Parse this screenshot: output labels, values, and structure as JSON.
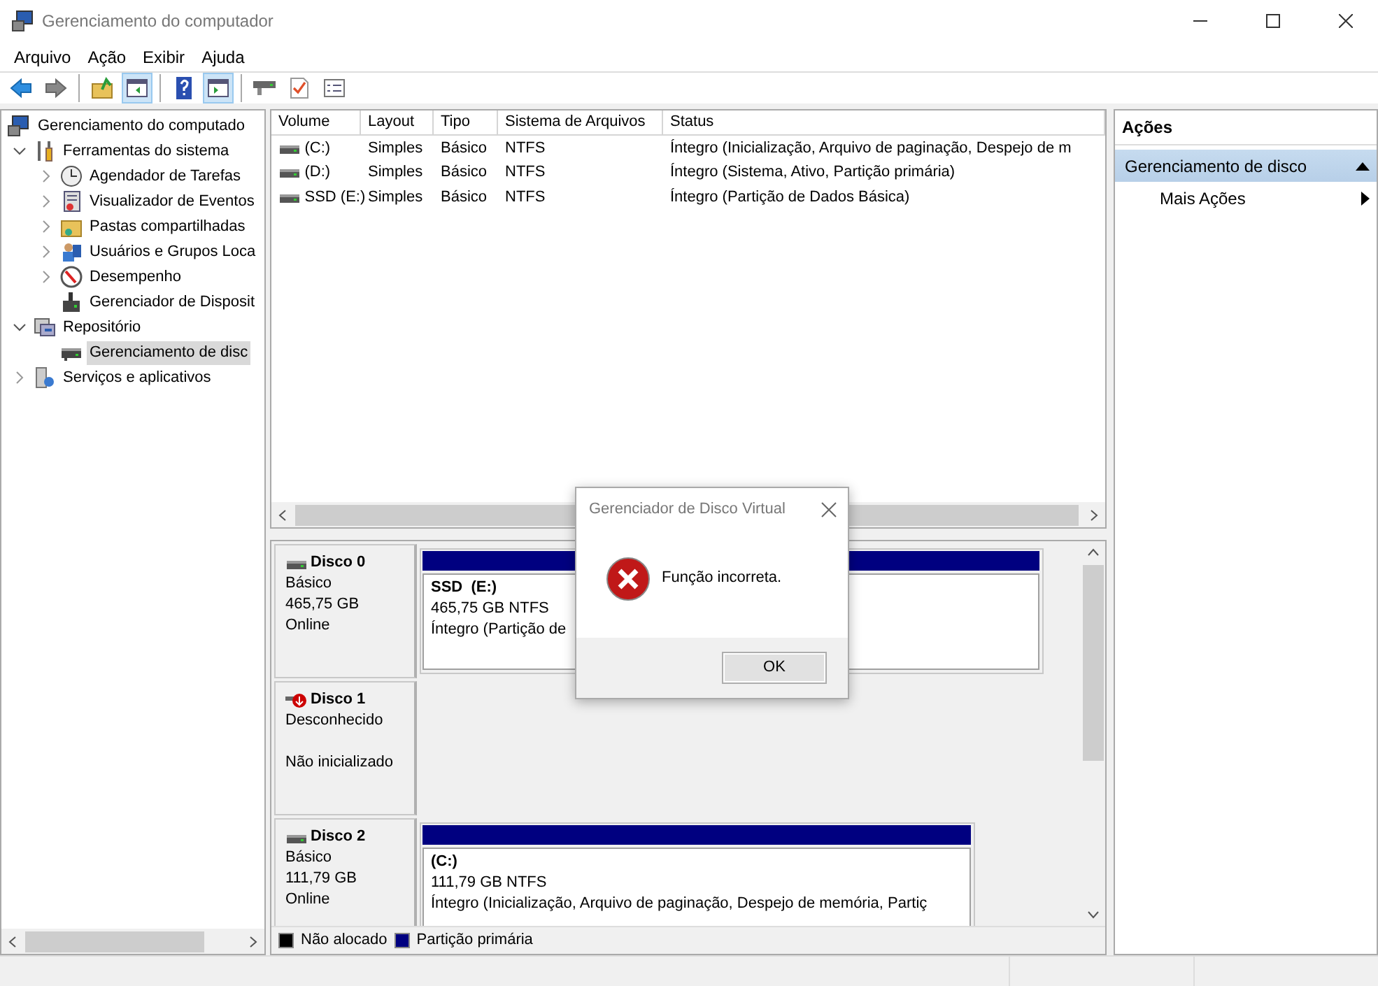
{
  "window": {
    "title": "Gerenciamento do computador"
  },
  "menu": [
    "Arquivo",
    "Ação",
    "Exibir",
    "Ajuda"
  ],
  "toolbar": [
    {
      "kind": "back",
      "pressed": false
    },
    {
      "kind": "forward",
      "pressed": false
    },
    {
      "kind": "sep"
    },
    {
      "kind": "up",
      "pressed": false
    },
    {
      "kind": "tree",
      "pressed": true
    },
    {
      "kind": "sep"
    },
    {
      "kind": "help",
      "pressed": false
    },
    {
      "kind": "actionpane",
      "pressed": true
    },
    {
      "kind": "sep"
    },
    {
      "kind": "drive",
      "pressed": false
    },
    {
      "kind": "check",
      "pressed": false
    },
    {
      "kind": "list",
      "pressed": false
    }
  ],
  "tree": [
    {
      "label": "Gerenciamento do computado",
      "selected": false,
      "children": [
        {
          "label": "Ferramentas do sistema",
          "expanded": true,
          "selected": false,
          "children": [
            {
              "label": "Agendador de Tarefas",
              "expanded": false,
              "selected": false
            },
            {
              "label": "Visualizador de Eventos",
              "expanded": false,
              "selected": false
            },
            {
              "label": "Pastas compartilhadas",
              "expanded": false,
              "selected": false
            },
            {
              "label": "Usuários e Grupos Loca",
              "expanded": false,
              "selected": false
            },
            {
              "label": "Desempenho",
              "expanded": false,
              "selected": false
            },
            {
              "label": "Gerenciador de Disposit",
              "selected": false
            }
          ]
        },
        {
          "label": "Repositório",
          "expanded": true,
          "selected": false,
          "children": [
            {
              "label": "Gerenciamento de disc",
              "selected": true
            }
          ]
        },
        {
          "label": "Serviços e aplicativos",
          "expanded": false,
          "selected": false
        }
      ]
    }
  ],
  "volumes": {
    "columns": [
      "Volume",
      "Layout",
      "Tipo",
      "Sistema de Arquivos",
      "Status"
    ],
    "rows": [
      [
        "(C:)",
        "Simples",
        "Básico",
        "NTFS",
        "Íntegro (Inicialização, Arquivo de paginação, Despejo de m"
      ],
      [
        "(D:)",
        "Simples",
        "Básico",
        "NTFS",
        "Íntegro (Sistema, Ativo, Partição primária)"
      ],
      [
        "SSD (E:)",
        "Simples",
        "Básico",
        "NTFS",
        "Íntegro (Partição de Dados Básica)"
      ]
    ]
  },
  "disks": [
    {
      "name": "Disco 0",
      "error": false,
      "lines": [
        "Básico",
        "465,75 GB",
        "Online"
      ],
      "partitions": [
        {
          "name": "SSD  (E:)",
          "size": "465,75 GB NTFS",
          "state": "Íntegro (Partição de"
        }
      ]
    },
    {
      "name": "Disco 1",
      "error": true,
      "lines": [
        "Desconhecido",
        "Não inicializado"
      ]
    },
    {
      "name": "Disco 2",
      "error": false,
      "lines": [
        "Básico",
        "111,79 GB",
        "Online"
      ],
      "partitions": [
        {
          "name": "(C:)",
          "size": "111,79 GB NTFS",
          "state": "Íntegro (Inicialização, Arquivo de paginação, Despejo de memória, Partiç"
        }
      ]
    }
  ],
  "legend": [
    {
      "label": "Não alocado",
      "color": "#000000"
    },
    {
      "label": "Partição primária",
      "color": "#000080"
    }
  ],
  "actions": {
    "title": "Ações",
    "items": [
      {
        "label": "Gerenciamento de disco",
        "kind": "section",
        "expanded": true
      },
      {
        "label": "Mais Ações",
        "kind": "submenu"
      }
    ]
  },
  "dialog": {
    "title": "Gerenciador de Disco Virtual",
    "message": "Função incorreta.",
    "button": "OK"
  }
}
